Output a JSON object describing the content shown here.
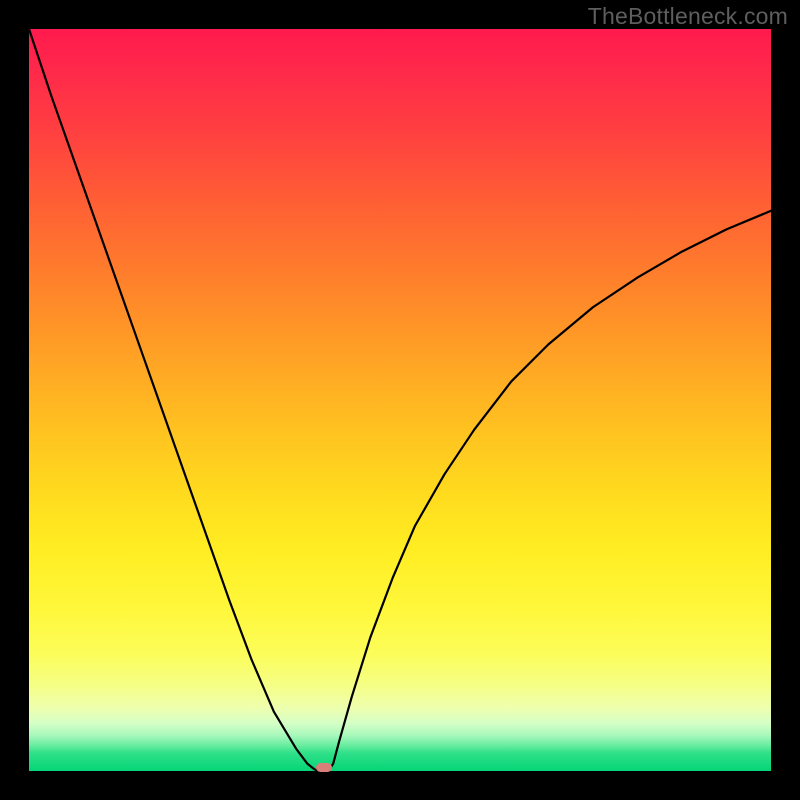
{
  "watermark": "TheBottleneck.com",
  "chart_data": {
    "type": "line",
    "title": "",
    "xlabel": "",
    "ylabel": "",
    "xlim": [
      0,
      100
    ],
    "ylim": [
      0,
      100
    ],
    "grid": false,
    "legend": false,
    "background_gradient": {
      "stops": [
        {
          "pos": 0.0,
          "color": "#ff1a4d"
        },
        {
          "pos": 0.5,
          "color": "#ffb822"
        },
        {
          "pos": 0.9,
          "color": "#f3ff88"
        },
        {
          "pos": 1.0,
          "color": "#04d576"
        }
      ]
    },
    "series": [
      {
        "name": "curve",
        "color": "#000000",
        "stroke_width": 2,
        "x": [
          0.0,
          3.0,
          6.0,
          9.0,
          12.0,
          15.0,
          18.0,
          21.0,
          24.0,
          27.0,
          30.0,
          33.0,
          36.0,
          37.5,
          38.5,
          39.5,
          40.5,
          41.0,
          41.8,
          43.5,
          46.0,
          49.0,
          52.0,
          56.0,
          60.0,
          65.0,
          70.0,
          76.0,
          82.0,
          88.0,
          94.0,
          100.0
        ],
        "y": [
          100.0,
          91.0,
          82.5,
          74.0,
          65.5,
          57.0,
          48.5,
          40.0,
          31.5,
          23.0,
          15.0,
          8.0,
          3.0,
          1.0,
          0.2,
          0.0,
          0.2,
          1.0,
          4.0,
          10.0,
          18.0,
          26.0,
          33.0,
          40.0,
          46.0,
          52.5,
          57.5,
          62.5,
          66.5,
          70.0,
          73.0,
          75.5
        ]
      }
    ],
    "marker": {
      "x": 39.8,
      "y": 0.0,
      "color": "#d97f7a"
    }
  }
}
